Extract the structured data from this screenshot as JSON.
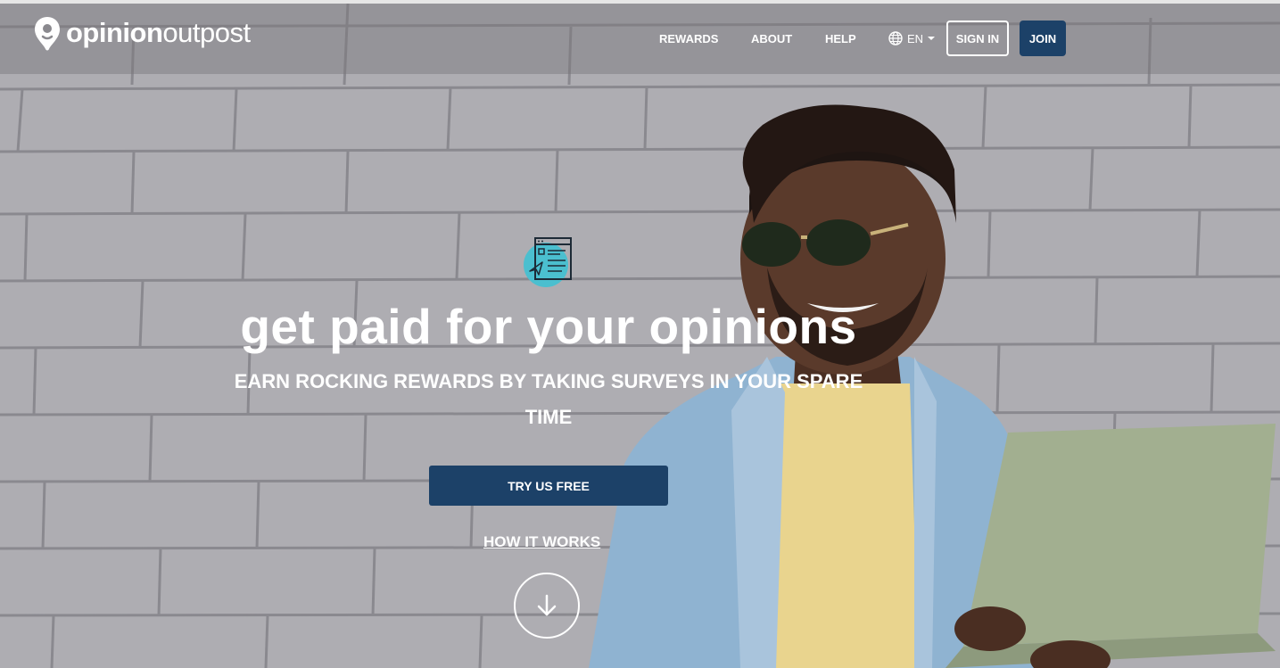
{
  "header": {
    "logo": {
      "bold": "opinion",
      "light": "outpost"
    },
    "nav": [
      {
        "label": "REWARDS"
      },
      {
        "label": "ABOUT"
      },
      {
        "label": "HELP"
      }
    ],
    "language": "EN",
    "sign_in": "SIGN IN",
    "join": "JOIN"
  },
  "hero": {
    "headline": "get paid for your opinions",
    "subheadline_line1": "EARN ROCKING REWARDS BY TAKING SURVEYS IN YOUR SPARE",
    "subheadline_line2": "TIME",
    "cta": "TRY US FREE",
    "how_it_works": "HOW IT WORKS"
  },
  "icons": {
    "logo_mark": "location-pin-icon",
    "feature": "survey-document-icon",
    "globe": "globe-icon",
    "caret": "caret-down-icon",
    "scroll": "arrow-down-icon"
  },
  "colors": {
    "primary": "#1c4168",
    "accent_teal": "#4bbfcf",
    "text": "#ffffff"
  }
}
